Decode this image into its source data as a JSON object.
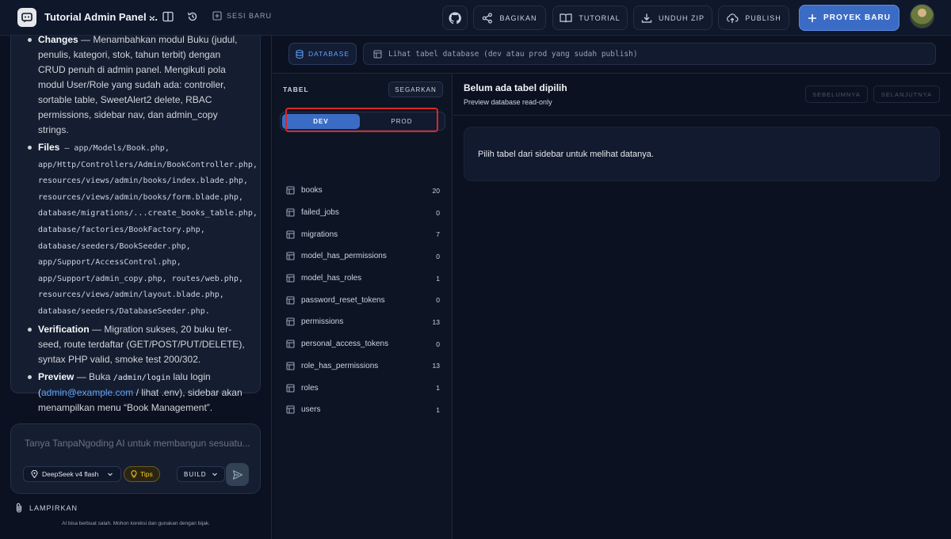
{
  "header": {
    "project_title": "Tutorial Admin Panel ...",
    "new_session": "SESI BARU",
    "buttons": {
      "share": "BAGIKAN",
      "tutorial": "TUTORIAL",
      "download_zip": "UNDUH ZIP",
      "publish": "PUBLISH",
      "new_project": "PROYEK BARU"
    }
  },
  "chat": {
    "items": {
      "changes_label": "Changes",
      "changes_text": " — Menambahkan modul Buku (judul, penulis, kategori, stok, tahun terbit) dengan CRUD penuh di admin panel. Mengikuti pola modul User/Role yang sudah ada: controller, sortable table, SweetAlert2 delete, RBAC permissions, sidebar nav, dan admin_copy strings.",
      "files_label": "Files",
      "files_text": " — app/Models/Book.php, app/Http/Controllers/Admin/BookController.php, resources/views/admin/books/index.blade.php, resources/views/admin/books/form.blade.php, database/migrations/...create_books_table.php, database/factories/BookFactory.php, database/seeders/BookSeeder.php, app/Support/AccessControl.php, app/Support/admin_copy.php, routes/web.php, resources/views/admin/layout.blade.php, database/seeders/DatabaseSeeder.php.",
      "verification_label": "Verification",
      "verification_text": " — Migration sukses, 20 buku ter-seed, route terdaftar (GET/POST/PUT/DELETE), syntax PHP valid, smoke test 200/302.",
      "preview_label": "Preview",
      "preview_text_1": " — Buka ",
      "preview_code": "/admin/login",
      "preview_text_2": " lalu login (",
      "preview_link": "admin@example.com",
      "preview_text_3": " / lihat .env), sidebar akan menampilkan menu “Book Management”."
    },
    "input_placeholder": "Tanya TanpaNgoding AI untuk membangun sesuatu...",
    "model": "DeepSeek v4 flash",
    "tips": "Tips",
    "mode": "BUILD",
    "attach": "LAMPIRKAN",
    "disclaimer": "AI bisa berbuat salah. Mohon koreksi dan gunakan dengan bijak."
  },
  "database": {
    "tab_label": "DATABASE",
    "bar_text": "Lihat tabel database (dev atau prod yang sudah publish)",
    "tables_title": "TABEL",
    "refresh": "SEGARKAN",
    "env_dev": "DEV",
    "env_prod": "PROD",
    "tables": [
      {
        "name": "books",
        "count": "20"
      },
      {
        "name": "failed_jobs",
        "count": "0"
      },
      {
        "name": "migrations",
        "count": "7"
      },
      {
        "name": "model_has_permissions",
        "count": "0"
      },
      {
        "name": "model_has_roles",
        "count": "1"
      },
      {
        "name": "password_reset_tokens",
        "count": "0"
      },
      {
        "name": "permissions",
        "count": "13"
      },
      {
        "name": "personal_access_tokens",
        "count": "0"
      },
      {
        "name": "role_has_permissions",
        "count": "13"
      },
      {
        "name": "roles",
        "count": "1"
      },
      {
        "name": "users",
        "count": "1"
      }
    ],
    "detail_title": "Belum ada tabel dipilih",
    "detail_subtitle": "Preview database read-only",
    "prev": "SEBELUMNYA",
    "next": "SELANJUTNYA",
    "empty_message": "Pilih tabel dari sidebar untuk melihat datanya."
  },
  "colors": {
    "accent": "#3b6cc5",
    "highlight": "#dc2626",
    "background": "#0b1120"
  }
}
